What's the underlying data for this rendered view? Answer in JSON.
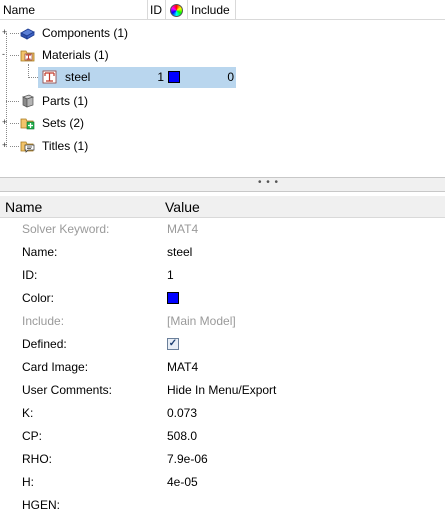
{
  "browser": {
    "columns": {
      "name": "Name",
      "id": "ID",
      "include": "Include"
    },
    "items": [
      {
        "label": "Components (1)",
        "expander": "+"
      },
      {
        "label": "Materials (1)",
        "expander": "-",
        "children": [
          {
            "label": "steel",
            "id": "1",
            "color": "#0000ff",
            "include": "0"
          }
        ]
      },
      {
        "label": "Parts (1)",
        "expander": ""
      },
      {
        "label": "Sets (2)",
        "expander": "+"
      },
      {
        "label": "Titles (1)",
        "expander": "+"
      }
    ],
    "splitter_grip": "• • •"
  },
  "properties": {
    "columns": {
      "name": "Name",
      "value": "Value"
    },
    "rows": [
      {
        "name": "Solver Keyword:",
        "value": "MAT4"
      },
      {
        "name": "Name:",
        "value": "steel"
      },
      {
        "name": "ID:",
        "value": "1"
      },
      {
        "name": "Color:",
        "value": "#0000ff"
      },
      {
        "name": "Include:",
        "value": "[Main Model]"
      },
      {
        "name": "Defined:",
        "value": "✓"
      },
      {
        "name": "Card Image:",
        "value": "MAT4"
      },
      {
        "name": "User Comments:",
        "value": "Hide In Menu/Export"
      },
      {
        "name": "K:",
        "value": "0.073"
      },
      {
        "name": "CP:",
        "value": "508.0"
      },
      {
        "name": "RHO:",
        "value": "7.9e-06"
      },
      {
        "name": "H:",
        "value": "4e-05"
      },
      {
        "name": "HGEN:",
        "value": ""
      }
    ]
  },
  "icons": {
    "components": "components-icon",
    "materials": "materials-icon",
    "material_item": "material-icon",
    "parts": "parts-icon",
    "sets": "sets-icon",
    "titles": "titles-icon",
    "color_column": "color-wheel-icon"
  }
}
